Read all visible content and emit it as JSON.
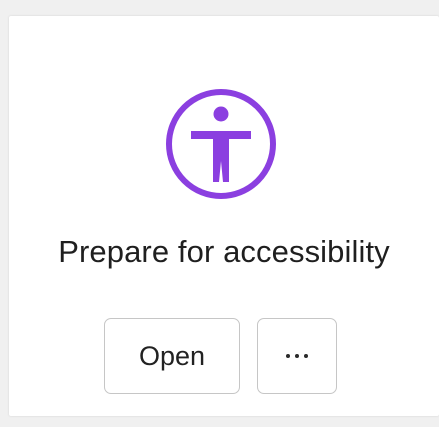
{
  "card": {
    "title": "Prepare for accessibility",
    "icon": "accessibility-icon",
    "accent_color": "#8B3FE0",
    "open_button_label": "Open",
    "more_button_icon": "ellipsis-icon"
  }
}
